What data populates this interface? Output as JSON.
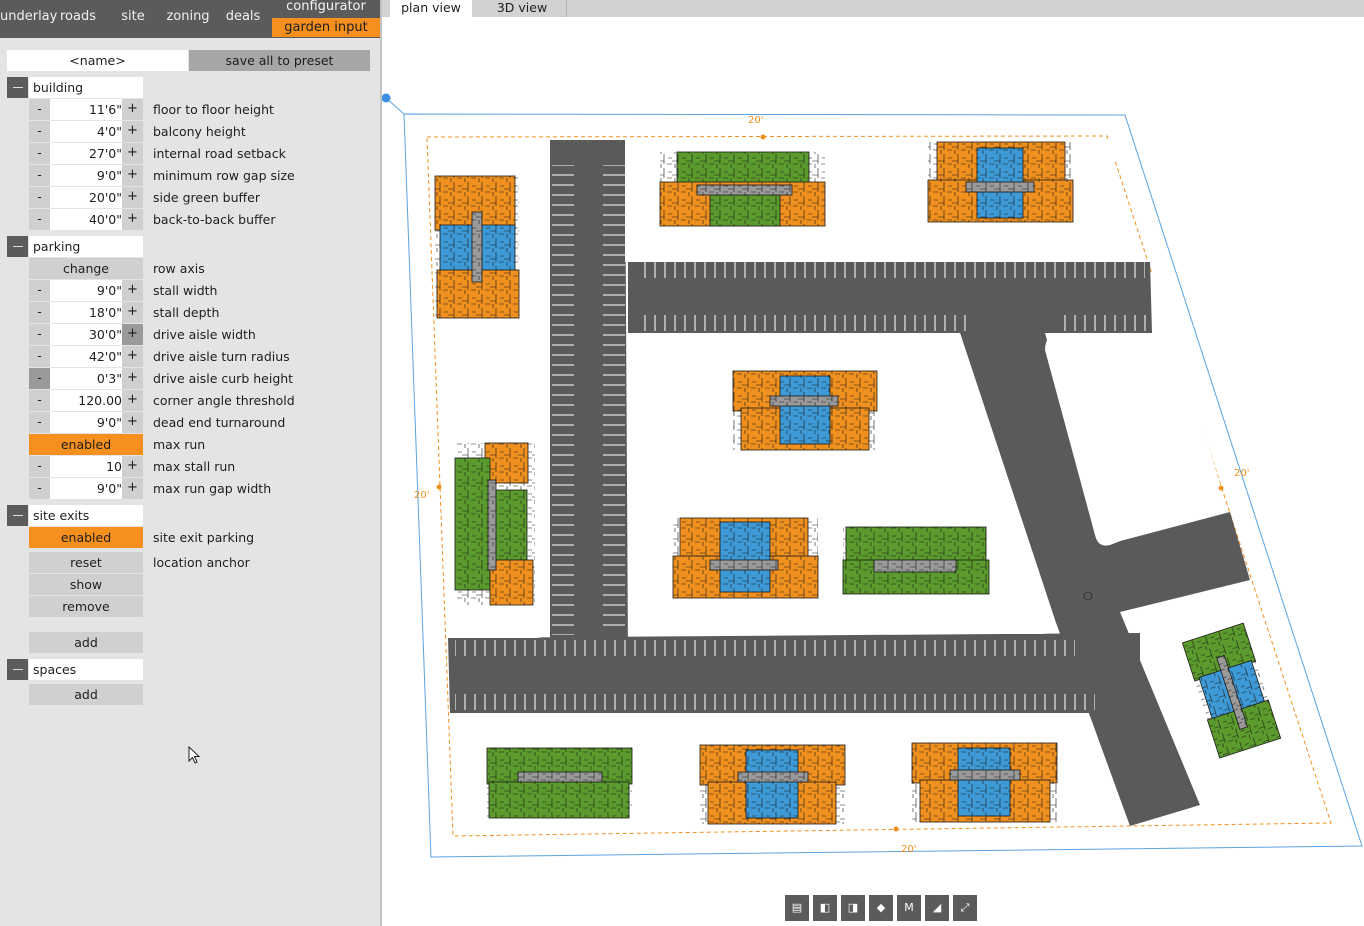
{
  "nav": {
    "tabs": [
      "underlay",
      "roads",
      "site",
      "zoning",
      "deals"
    ],
    "configurator": "configurator",
    "garden_input": "garden input"
  },
  "preset": {
    "name": "<name>",
    "save_label": "save all to preset"
  },
  "building": {
    "title": "building",
    "rows": [
      {
        "value": "11'6\"",
        "label": "floor to floor height"
      },
      {
        "value": "4'0\"",
        "label": "balcony height"
      },
      {
        "value": "27'0\"",
        "label": "internal road setback"
      },
      {
        "value": "9'0\"",
        "label": "minimum row gap size"
      },
      {
        "value": "20'0\"",
        "label": "side green buffer"
      },
      {
        "value": "40'0\"",
        "label": "back-to-back buffer"
      }
    ]
  },
  "parking": {
    "title": "parking",
    "row_axis": {
      "button": "change",
      "label": "row axis"
    },
    "rows": [
      {
        "value": "9'0\"",
        "label": "stall width"
      },
      {
        "value": "18'0\"",
        "label": "stall depth"
      },
      {
        "value": "30'0\"",
        "label": "drive aisle width"
      },
      {
        "value": "42'0\"",
        "label": "drive aisle turn radius"
      },
      {
        "value": "0'3\"",
        "label": "drive aisle curb height"
      },
      {
        "value": "120.00",
        "label": "corner angle threshold"
      },
      {
        "value": "9'0\"",
        "label": "dead end turnaround"
      }
    ],
    "max_run": {
      "button": "enabled",
      "label": "max run"
    },
    "rows2": [
      {
        "value": "10",
        "label": "max stall run"
      },
      {
        "value": "9'0\"",
        "label": "max run gap width"
      }
    ]
  },
  "site_exits": {
    "title": "site exits",
    "exit_parking": {
      "button": "enabled",
      "label": "site exit parking"
    },
    "reset": "reset",
    "location_anchor": "location anchor",
    "show": "show",
    "remove": "remove",
    "add": "add"
  },
  "spaces": {
    "title": "spaces",
    "add": "add"
  },
  "stepper": {
    "minus": "-",
    "plus": "+"
  },
  "view_tabs": {
    "plan": "plan view",
    "threed": "3D view"
  },
  "dimensions": {
    "top": "20'",
    "left": "20'",
    "right": "20'",
    "bottom": "20'"
  },
  "toolbar_m": "M",
  "colors": {
    "orange": "#f0901e",
    "green": "#5b9a2c",
    "blue": "#3d9ad6",
    "asphalt": "#5c5c5c",
    "accent": "#f5901e"
  }
}
